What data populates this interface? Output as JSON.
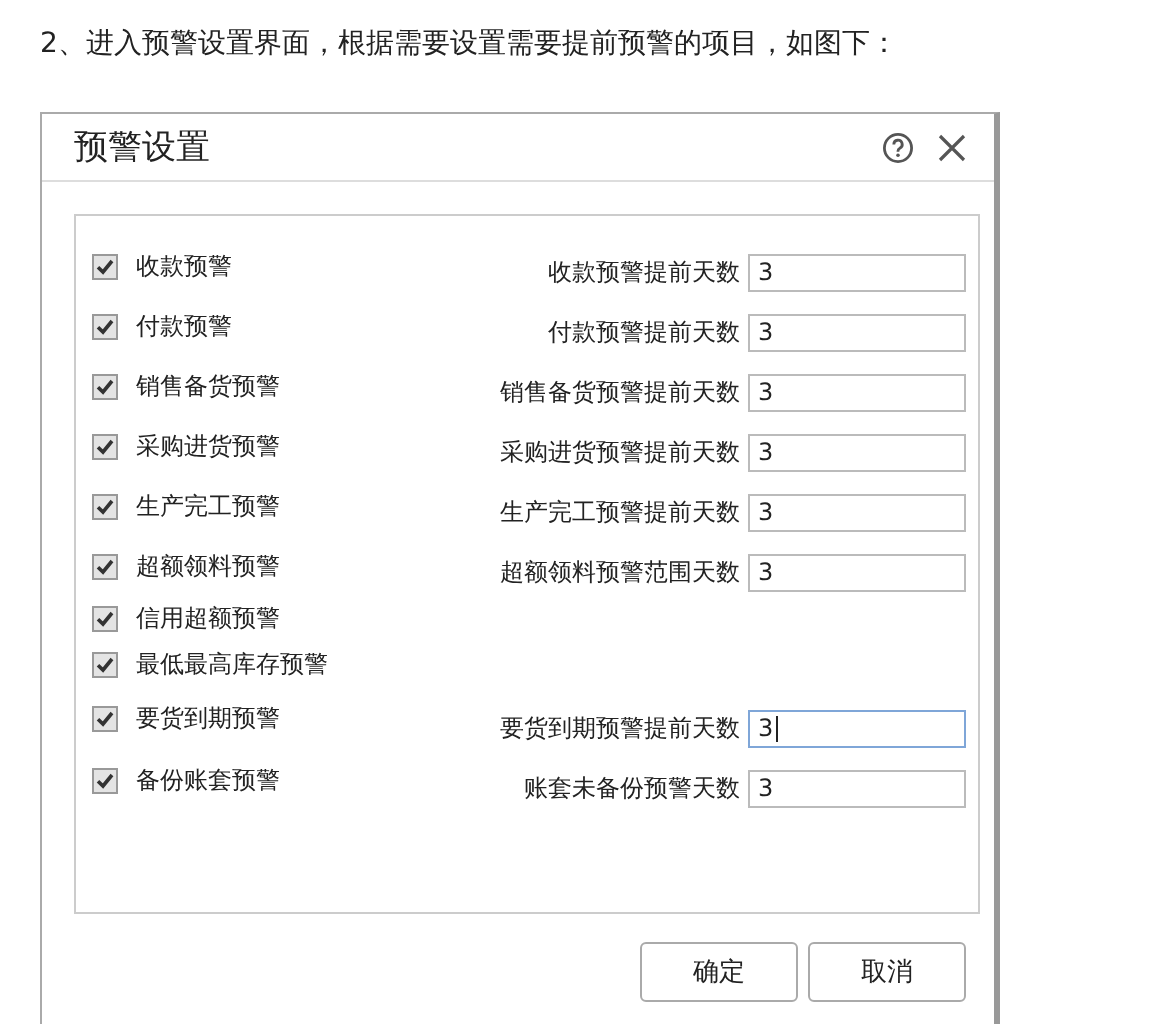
{
  "intro": "2、进入预警设置界面，根据需要设置需要提前预警的项目，如图下：",
  "dialog": {
    "title": "预警设置"
  },
  "warnings": [
    {
      "label": "收款预警",
      "checked": true
    },
    {
      "label": "付款预警",
      "checked": true
    },
    {
      "label": "销售备货预警",
      "checked": true
    },
    {
      "label": "采购进货预警",
      "checked": true
    },
    {
      "label": "生产完工预警",
      "checked": true
    },
    {
      "label": "超额领料预警",
      "checked": true
    },
    {
      "label": "信用超额预警",
      "checked": true
    },
    {
      "label": "最低最高库存预警",
      "checked": true
    },
    {
      "label": "要货到期预警",
      "checked": true
    },
    {
      "label": "备份账套预警",
      "checked": true
    }
  ],
  "fields": [
    {
      "label": "收款预警提前天数",
      "value": "3",
      "focused": false
    },
    {
      "label": "付款预警提前天数",
      "value": "3",
      "focused": false
    },
    {
      "label": "销售备货预警提前天数",
      "value": "3",
      "focused": false
    },
    {
      "label": "采购进货预警提前天数",
      "value": "3",
      "focused": false
    },
    {
      "label": "生产完工预警提前天数",
      "value": "3",
      "focused": false
    },
    {
      "label": "超额领料预警范围天数",
      "value": "3",
      "focused": false
    },
    {
      "label": "要货到期预警提前天数",
      "value": "3",
      "focused": true
    },
    {
      "label": "账套未备份预警天数",
      "value": "3",
      "focused": false
    }
  ],
  "buttons": [
    "确定",
    "取消"
  ]
}
